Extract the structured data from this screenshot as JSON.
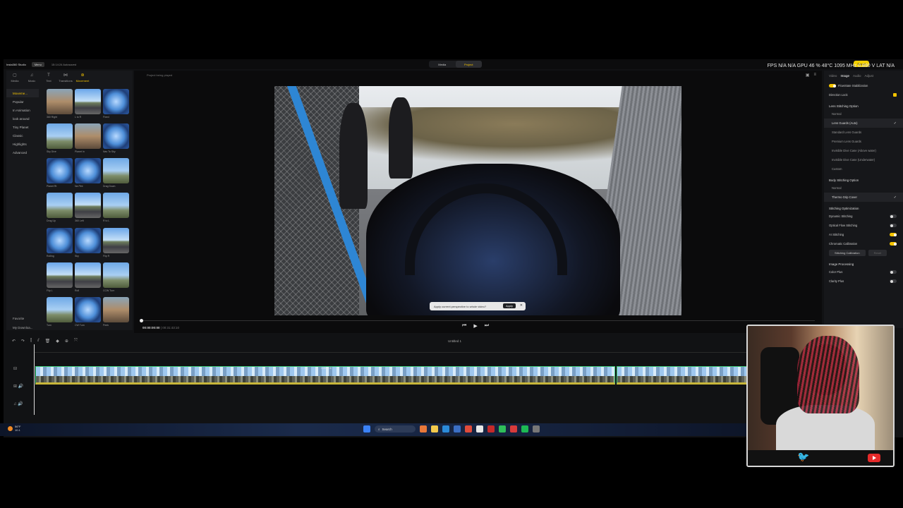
{
  "titlebar": {
    "app_name": "Insta360 Studio",
    "menu": "Menu",
    "saved": "15:14:24 Autosaved",
    "modes": [
      "Media",
      "Project"
    ],
    "export": "Export",
    "stats": "FPS N/A N/A   GPU 46 % 48°C 1095 MHz 0.890 V   LAT N/A"
  },
  "left_tabs": [
    {
      "icon": "media-icon",
      "label": "Media"
    },
    {
      "icon": "music-icon",
      "label": "Music"
    },
    {
      "icon": "text-icon",
      "label": "Text"
    },
    {
      "icon": "transitions-icon",
      "label": "Transitions"
    },
    {
      "icon": "movement-icon",
      "label": "Movement"
    }
  ],
  "categories": [
    "Moveme...",
    "Popular",
    "In Animation",
    "look around",
    "Tiny Planet",
    "Classic",
    "Highlights",
    "Advanced"
  ],
  "category_footer": [
    "Favorite",
    "My Downloa..."
  ],
  "effects": [
    {
      "label": "360 Right",
      "style": "brown"
    },
    {
      "label": "L to R",
      "style": "road"
    },
    {
      "label": "Fixed",
      "style": "orb"
    },
    {
      "label": "Sky Dive",
      "style": "plain"
    },
    {
      "label": "Planet In",
      "style": "brown"
    },
    {
      "label": "Nav To Sky",
      "style": "orb"
    },
    {
      "label": "Planet Rt",
      "style": "orb"
    },
    {
      "label": "Na Pint",
      "style": "orb"
    },
    {
      "label": "Drag Down",
      "style": "plain"
    },
    {
      "label": "Drag Up",
      "style": "plain"
    },
    {
      "label": "360 Left",
      "style": "road"
    },
    {
      "label": "R to L",
      "style": "plain"
    },
    {
      "label": "Rolling",
      "style": "orb"
    },
    {
      "label": "Sky",
      "style": "orb"
    },
    {
      "label": "Flip R",
      "style": "road"
    },
    {
      "label": "Flip L",
      "style": "road"
    },
    {
      "label": "Roll",
      "style": "road"
    },
    {
      "label": "CCW Turn",
      "style": "plain"
    },
    {
      "label": "Turn",
      "style": "plain"
    },
    {
      "label": "CW Turn",
      "style": "orb"
    },
    {
      "label": "Peek",
      "style": "brown"
    }
  ],
  "preview": {
    "toolbar_label": "Project being played",
    "popup_text": "Apply current perspective to whole video?",
    "popup_apply": "Apply",
    "timecode_current": "00:00:00:00",
    "timecode_total": "00:31:43:10"
  },
  "right_panel": {
    "tabs": [
      "Video",
      "Image",
      "Audio",
      "Adjust"
    ],
    "active_tab": "Image",
    "flowstate": "FlowState Stabilization",
    "direction_lock": "Direction Lock",
    "lens_section": "Lens Stitching Option",
    "lens_options": [
      "Normal",
      "Lens Guards (Auto)",
      "Standard Lens Guards",
      "Premium Lens Guards",
      "Invisible Dive Case (Above water)",
      "Invisible Dive Case (Underwater)",
      "Custom"
    ],
    "body_section": "Body Stitching Option",
    "body_options": [
      "Normal",
      "Thermo Grip Cover"
    ],
    "opt_section": "Stitching Optimization",
    "opt_items": [
      {
        "label": "Dynamic Stitching",
        "on": false
      },
      {
        "label": "Optical Flow Stitching",
        "on": false
      },
      {
        "label": "AI Stitching",
        "on": true
      },
      {
        "label": "Chromatic Calibration",
        "on": true
      }
    ],
    "calib_button": "Stitching Calibration",
    "reset_button": "Reset",
    "img_section": "Image Processing",
    "img_items": [
      {
        "label": "Color Plus",
        "on": false
      },
      {
        "label": "Clarity Plus",
        "on": false
      }
    ]
  },
  "timeline": {
    "title": "Untitled 1",
    "clip_label": "1:45 / 1:4"
  },
  "taskbar": {
    "weather_temp": "56°F",
    "weather_desc": "10.1",
    "search": "Search"
  }
}
